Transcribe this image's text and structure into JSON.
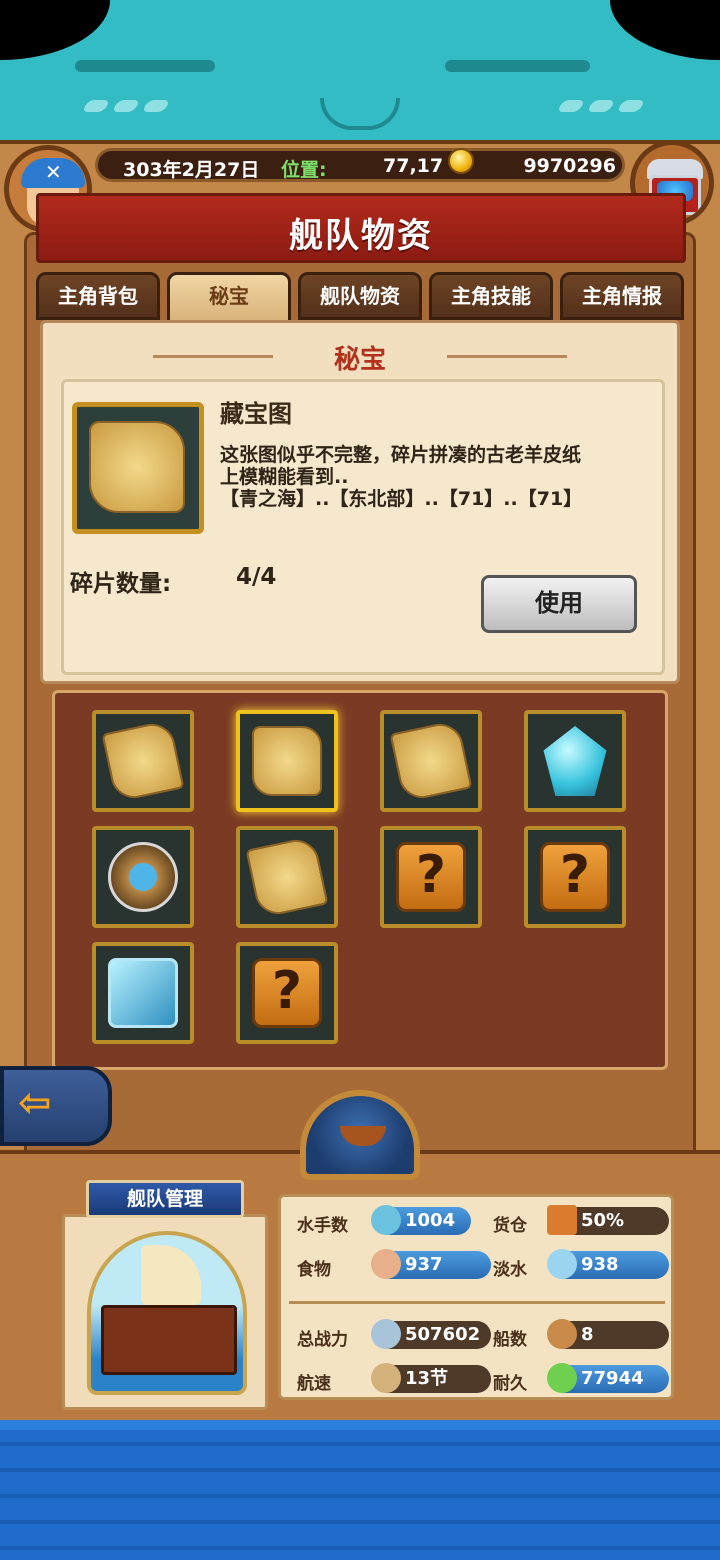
{
  "header": {
    "date": "303年2月27日",
    "position_label": "位置:",
    "position_value": "77,17",
    "gold": "9970296",
    "title": "舰队物资"
  },
  "tabs": [
    {
      "label": "主角背包",
      "active": false
    },
    {
      "label": "秘宝",
      "active": true
    },
    {
      "label": "舰队物资",
      "active": false
    },
    {
      "label": "主角技能",
      "active": false
    },
    {
      "label": "主角情报",
      "active": false
    }
  ],
  "detail": {
    "section_title": "秘宝",
    "item_name": "藏宝图",
    "item_desc_line1": "这张图似乎不完整，碎片拼凑的古老羊皮纸",
    "item_desc_line2": "上模糊能看到..",
    "item_desc_line3": "【青之海】..【东北部】..【71】..【71】",
    "fragment_label": "碎片数量:",
    "fragment_value": "4/4",
    "use_button": "使用"
  },
  "inventory": [
    {
      "icon": "map-fragment-icon"
    },
    {
      "icon": "treasure-map-icon",
      "selected": true
    },
    {
      "icon": "map-fragment-icon"
    },
    {
      "icon": "crystal-icon"
    },
    {
      "icon": "compass-icon"
    },
    {
      "icon": "map-fragment-icon"
    },
    {
      "icon": "unknown-item-icon",
      "text": "?"
    },
    {
      "icon": "unknown-item-icon",
      "text": "?"
    },
    {
      "icon": "ice-cube-icon"
    },
    {
      "icon": "unknown-item-icon",
      "text": "?"
    }
  ],
  "fleet": {
    "title": "舰队管理",
    "sailors_label": "水手数",
    "sailors_value": "1004",
    "cargo_label": "货仓",
    "cargo_value": "50%",
    "food_label": "食物",
    "food_value": "937",
    "water_label": "淡水",
    "water_value": "938",
    "power_label": "总战力",
    "power_value": "507602",
    "ships_label": "船数",
    "ships_value": "8",
    "speed_label": "航速",
    "speed_value": "13节",
    "durability_label": "耐久",
    "durability_value": "77944"
  },
  "colors": {
    "accent_red": "#b22a1c",
    "teal": "#33bcc3",
    "gold": "#f0b20c"
  }
}
